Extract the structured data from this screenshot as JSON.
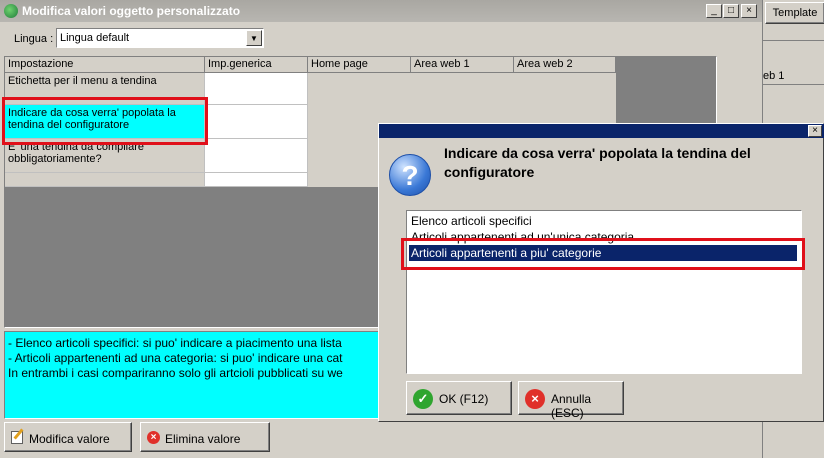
{
  "window": {
    "title": "Modifica valori oggetto personalizzato",
    "min": "_",
    "max": "□",
    "close": "×"
  },
  "lingua": {
    "label": "Lingua :",
    "value": "Lingua default"
  },
  "grid": {
    "headers": [
      "Impostazione",
      "Imp.generica",
      "Home page",
      "Area web 1",
      "Area web 2"
    ],
    "rows": [
      "Etichetta per il menu a tendina",
      "Indicare da cosa verra' popolata la tendina del configuratore",
      "E' una tendina da compilare obbligatoriamente?"
    ]
  },
  "info": {
    "lines": [
      "- Elenco articoli specifici: si puo' indicare a piacimento una lista",
      "- Articoli appartenenti ad una categoria: si puo' indicare una cat",
      "In entrambi i casi compariranno solo gli artcioli pubblicati su we"
    ]
  },
  "buttons": {
    "modifica": "Modifica valore",
    "elimina": "Elimina valore"
  },
  "background": {
    "template_tab": "Template",
    "side_label": "eb 1"
  },
  "dialog": {
    "close": "×",
    "question": "Indicare da cosa verra' popolata la tendina del configuratore",
    "options": [
      "Elenco articoli specifici",
      "Articoli appartenenti ad un'unica categoria",
      "Articoli appartenenti a piu' categorie"
    ],
    "selected_index": 2,
    "ok_label": "OK (F12)",
    "cancel_label": "Annulla (ESC)"
  },
  "colors": {
    "selection": "#0a246a",
    "highlight_row": "#00ffff",
    "info_bg": "#00ffff",
    "title_dialog": "#0a246a"
  }
}
